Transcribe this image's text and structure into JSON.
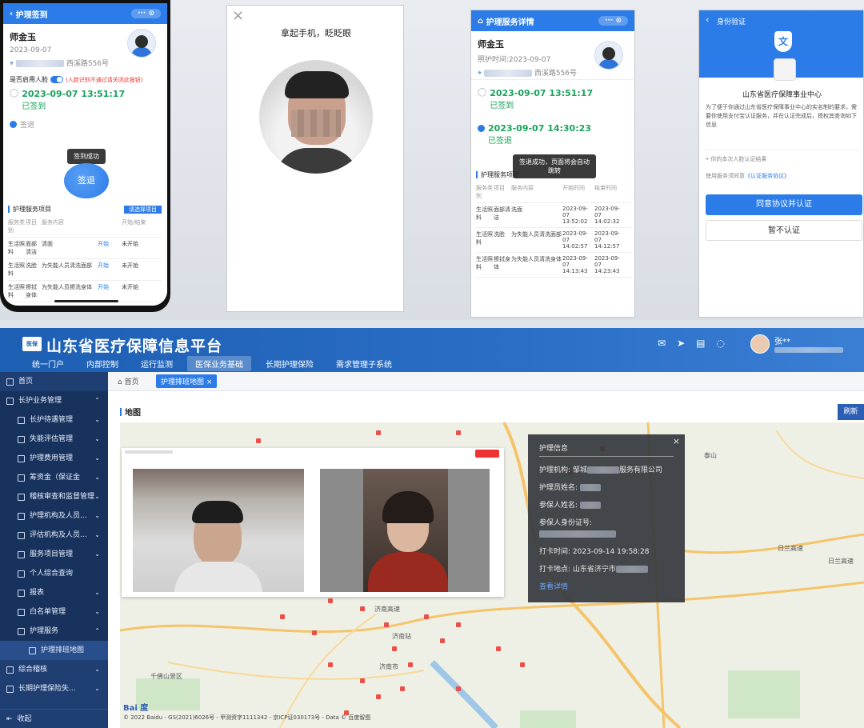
{
  "phone1": {
    "header": "护理签到",
    "name": "师金玉",
    "date": "2023-09-07",
    "address_suffix": "西溪路556号",
    "face_toggle_label": "是否启用人脸",
    "face_toggle_note": "(人脸识别不通过请关闭此按钮)",
    "checkin_time": "2023-09-07 13:51:17",
    "checkin_status": "已签到",
    "checkout_status": "签退",
    "toast": "签到成功",
    "checkout_button": "签退",
    "service_title": "护理服务项目",
    "service_tag": "请选择项目",
    "table_headers": [
      "服务类别",
      "项目",
      "服务内容",
      "",
      "开始/结束"
    ],
    "table_rows": [
      [
        "生活照料",
        "面部清洁",
        "清面",
        "开始",
        "未开始"
      ],
      [
        "生活照料",
        "洗脸",
        "为失能人员清洗面部",
        "开始",
        "未开始"
      ],
      [
        "生活照料",
        "擦拭身体",
        "为失能人员擦洗身体",
        "开始",
        "未开始"
      ]
    ]
  },
  "face_capture": {
    "close": "×",
    "instruction": "拿起手机，眨眨眼"
  },
  "phone3": {
    "header": "护理服务详情",
    "name": "师金玉",
    "date_label": "照护时间:2023-09-07",
    "address_suffix": "西溪路556号",
    "checkin_time": "2023-09-07 13:51:17",
    "checkin_status": "已签到",
    "checkout_time": "2023-09-07 14:30:23",
    "checkout_status": "已签退",
    "toast": "签退成功，页面将会自动跳转",
    "service_title": "护理服务项目",
    "table_headers": [
      "服务类别",
      "项目",
      "服务内容",
      "开始时间",
      "结束时间"
    ],
    "table_rows": [
      [
        "生活照料",
        "面部清洁",
        "洗面",
        "2023-09-07 13:52:02",
        "2023-09-07 14:02:32"
      ],
      [
        "生活照料",
        "洗脸",
        "为失能人员清洗面部",
        "2023-09-07 14:02:57",
        "2023-09-07 14:12:57"
      ],
      [
        "生活照料",
        "擦拭身体",
        "为失能人员清洗身体",
        "2023-09-07 14:13:43",
        "2023-09-07 14:23:43"
      ]
    ]
  },
  "phone4": {
    "header": "身份验证",
    "org": "山东省医疗保障事业中心",
    "description": "为了便于你通过山东省医疗保障事业中心的实名制的要求，需要你使用支付宝认证服务，并在认证完成后，授权其查询如下信息",
    "bullet": "• 你的本次人脸认证结果",
    "agreement_prefix": "使用服务须同意",
    "agreement_link": "《认证服务协议》",
    "agree_button": "同意协议并认证",
    "decline_button": "暂不认证"
  },
  "desktop": {
    "logo_text": "医保",
    "title": "山东省医疗保障信息平台",
    "nav": [
      "统一门户",
      "内部控制",
      "运行监测",
      "医保业务基础",
      "长期护理保险",
      "需求管理子系统"
    ],
    "nav_active": 3,
    "user_name": "张**",
    "sidebar": [
      {
        "label": "首页",
        "level": 0,
        "chev": ""
      },
      {
        "label": "长护业务管理",
        "level": 0,
        "chev": "⌃"
      },
      {
        "label": "长护待遇管理",
        "level": 1,
        "chev": "⌄"
      },
      {
        "label": "失能评估管理",
        "level": 1,
        "chev": "⌄"
      },
      {
        "label": "护理费用管理",
        "level": 1,
        "chev": "⌄"
      },
      {
        "label": "筹资金（保证金",
        "level": 1,
        "chev": "⌄"
      },
      {
        "label": "稽核审查和监督管理",
        "level": 1,
        "chev": "⌄"
      },
      {
        "label": "护理机构及人员...",
        "level": 1,
        "chev": "⌄"
      },
      {
        "label": "评估机构及人员...",
        "level": 1,
        "chev": "⌄"
      },
      {
        "label": "服务项目管理",
        "level": 1,
        "chev": "⌄"
      },
      {
        "label": "个人综合查询",
        "level": 1,
        "chev": ""
      },
      {
        "label": "报表",
        "level": 1,
        "chev": "⌄"
      },
      {
        "label": "白名单管理",
        "level": 1,
        "chev": "⌄"
      },
      {
        "label": "护理服务",
        "level": 1,
        "chev": "⌃"
      },
      {
        "label": "护理排班地图",
        "level": 2,
        "chev": ""
      },
      {
        "label": "综合稽核",
        "level": 0,
        "chev": "⌄"
      },
      {
        "label": "长期护理保险失...",
        "level": 0,
        "chev": "⌄"
      },
      {
        "label": "收起",
        "level": 0,
        "chev": ""
      }
    ],
    "tab_home": "首页",
    "tab_active": "护理排班地图",
    "section_title": "地图",
    "refresh_button": "刷新",
    "popup": {
      "title": "护理信息",
      "org_label": "护理机构:",
      "org_value": "邹城",
      "org_suffix": "服务有限公司",
      "staff_label": "护理员姓名:",
      "insured_label": "参保人姓名:",
      "id_label": "参保人身份证号:",
      "time_label": "打卡时间:",
      "time_value": "2023-09-14 19:58:28",
      "place_label": "打卡地点:",
      "place_value": "山东省济宁市",
      "link": "查看详情"
    },
    "map_labels": [
      "济南高速",
      "日兰高速",
      "日兰高速",
      "济南市",
      "济南站",
      "千佛山景区",
      "泰山"
    ],
    "copyright": "© 2022 Baidu - GS(2021)6026号 - 甲测资字1111342 - 京ICP证030173号 - Data © 百度智图",
    "baidu_logo": "Bai 度"
  }
}
